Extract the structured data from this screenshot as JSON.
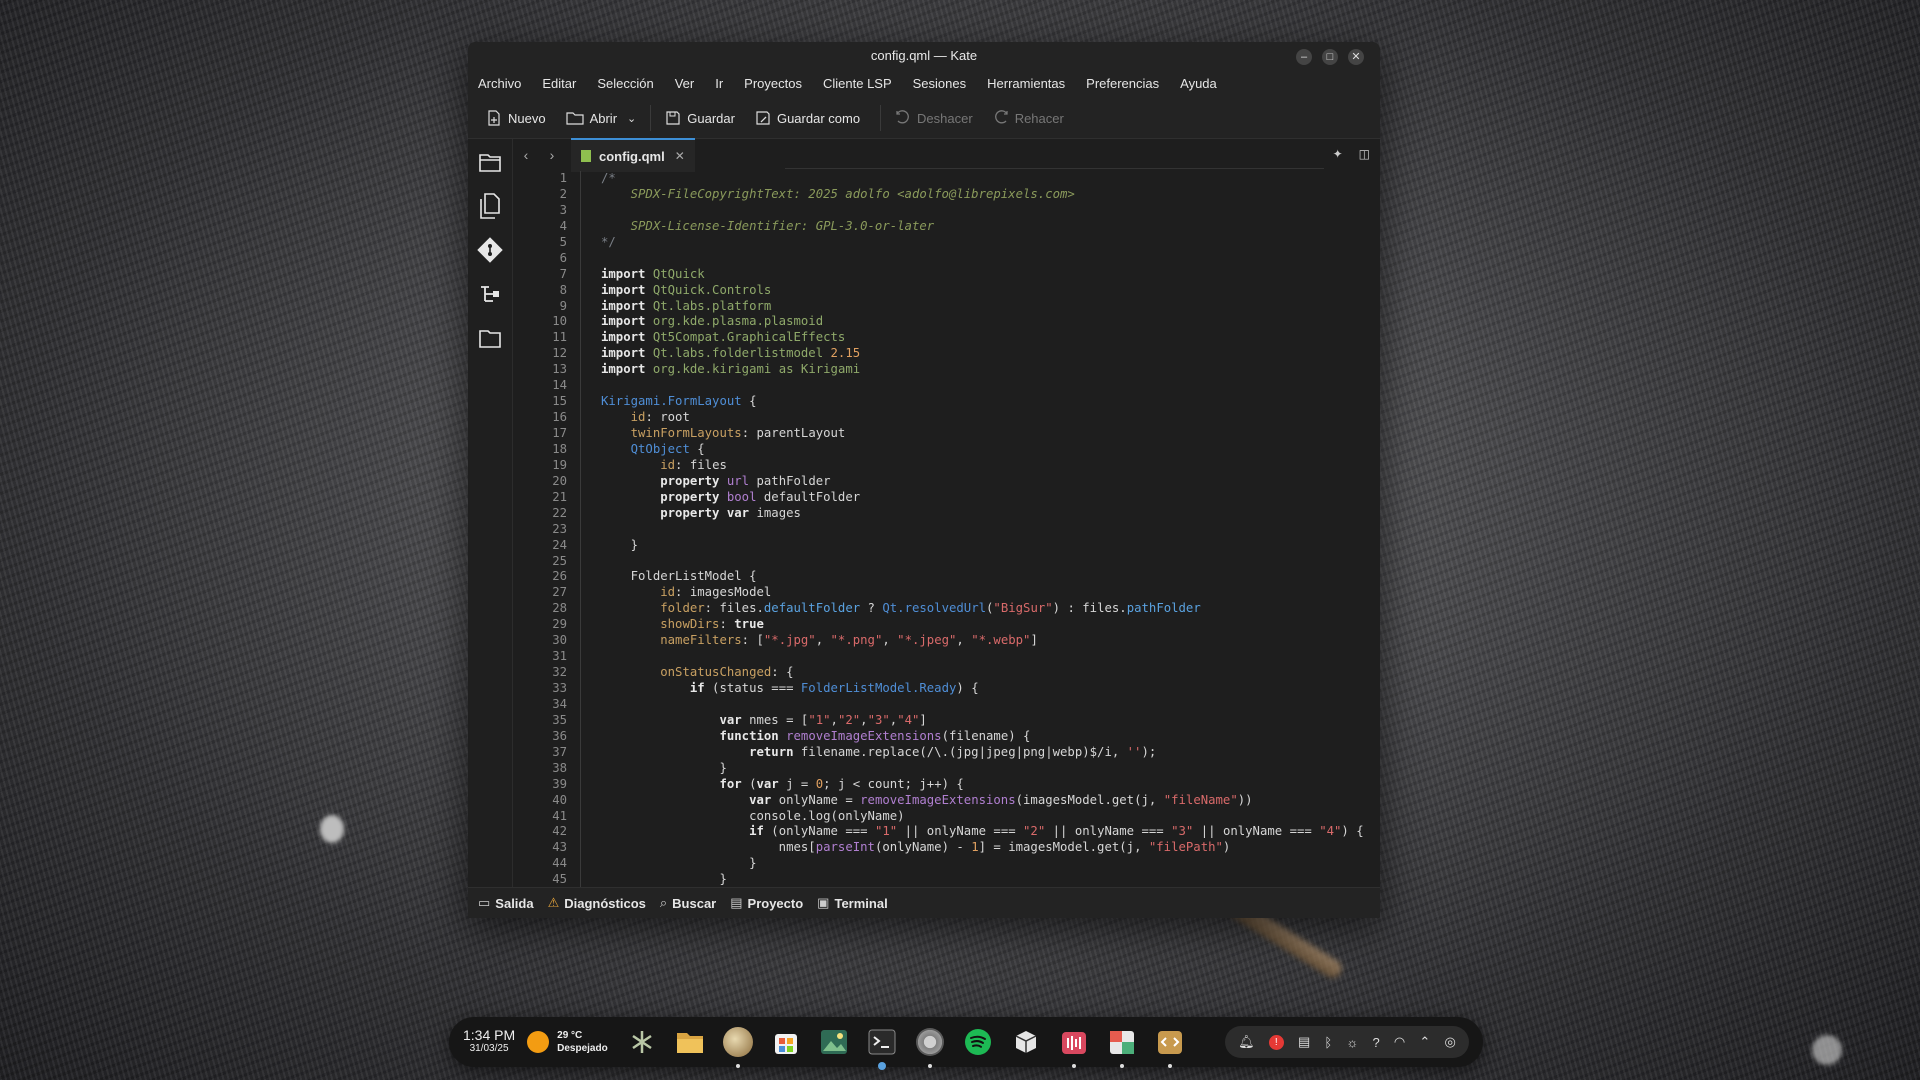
{
  "window": {
    "title": "config.qml — Kate",
    "menu": [
      "Archivo",
      "Editar",
      "Selección",
      "Ver",
      "Ir",
      "Proyectos",
      "Cliente LSP",
      "Sesiones",
      "Herramientas",
      "Preferencias",
      "Ayuda"
    ],
    "toolbar": {
      "new": "Nuevo",
      "open": "Abrir",
      "save": "Guardar",
      "save_as": "Guardar como",
      "undo": "Deshacer",
      "redo": "Rehacer"
    },
    "tab": {
      "filename": "config.qml"
    },
    "bottom_tabs": {
      "output": "Salida",
      "diagnostics": "Diagnósticos",
      "search": "Buscar",
      "project": "Proyecto",
      "terminal": "Terminal"
    }
  },
  "code_lines": [
    "/*",
    "    SPDX-FileCopyrightText: 2025 adolfo <adolfo@librepixels.com>",
    "",
    "    SPDX-License-Identifier: GPL-3.0-or-later",
    "*/",
    "",
    "import QtQuick",
    "import QtQuick.Controls",
    "import Qt.labs.platform",
    "import org.kde.plasma.plasmoid",
    "import Qt5Compat.GraphicalEffects",
    "import Qt.labs.folderlistmodel 2.15",
    "import org.kde.kirigami as Kirigami",
    "",
    "Kirigami.FormLayout {",
    "    id: root",
    "    twinFormLayouts: parentLayout",
    "    QtObject {",
    "        id: files",
    "        property url pathFolder",
    "        property bool defaultFolder",
    "        property var images",
    "",
    "    }",
    "",
    "    FolderListModel {",
    "        id: imagesModel",
    "        folder: files.defaultFolder ? Qt.resolvedUrl(\"BigSur\") : files.pathFolder",
    "        showDirs: true",
    "        nameFilters: [\"*.jpg\", \"*.png\", \"*.jpeg\", \"*.webp\"]",
    "",
    "        onStatusChanged: {",
    "            if (status === FolderListModel.Ready) {",
    "",
    "                var nmes = [\"1\",\"2\",\"3\",\"4\"]",
    "                function removeImageExtensions(filename) {",
    "                    return filename.replace(/\\.(jpg|jpeg|png|webp)$/i, '');",
    "                }",
    "                for (var j = 0; j < count; j++) {",
    "                    var onlyName = removeImageExtensions(imagesModel.get(j, \"fileName\"))",
    "                    console.log(onlyName)",
    "                    if (onlyName === \"1\" || onlyName === \"2\" || onlyName === \"3\" || onlyName === \"4\") {",
    "                        nmes[parseInt(onlyName) - 1] = imagesModel.get(j, \"filePath\")",
    "                    }",
    "                }"
  ],
  "taskbar": {
    "time": "1:34 PM",
    "date": "31/03/25",
    "temperature": "29 °C",
    "weather": "Despejado",
    "apps": [
      "kde-icon",
      "folder-icon",
      "browser-icon",
      "store-icon",
      "image-viewer-icon",
      "terminal-icon",
      "settings-icon",
      "spotify-icon",
      "package-icon",
      "audio-recorder-icon",
      "calendar-icon",
      "code-editor-icon"
    ],
    "colors": {
      "accent": "#3d8fd6",
      "weather_sun": "#f39c12"
    }
  }
}
